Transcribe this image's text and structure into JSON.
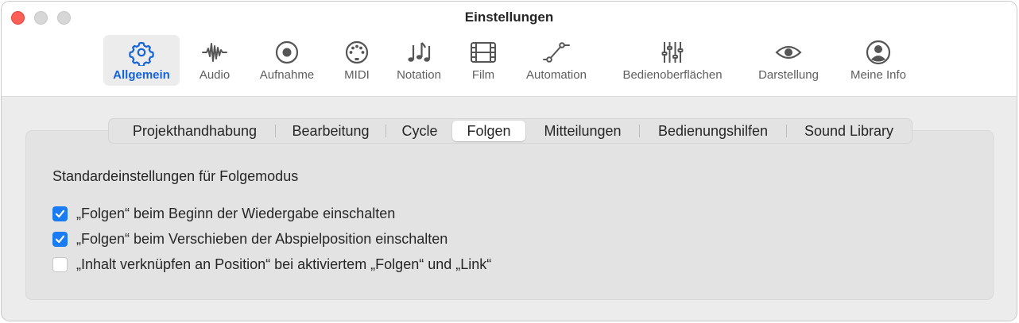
{
  "window": {
    "title": "Einstellungen"
  },
  "toolbar": {
    "items": [
      {
        "label": "Allgemein",
        "icon": "gear-icon",
        "selected": true
      },
      {
        "label": "Audio",
        "icon": "waveform-icon",
        "selected": false
      },
      {
        "label": "Aufnahme",
        "icon": "record-icon",
        "selected": false
      },
      {
        "label": "MIDI",
        "icon": "midi-connector-icon",
        "selected": false
      },
      {
        "label": "Notation",
        "icon": "music-notes-icon",
        "selected": false
      },
      {
        "label": "Film",
        "icon": "film-strip-icon",
        "selected": false
      },
      {
        "label": "Automation",
        "icon": "automation-curve-icon",
        "selected": false
      },
      {
        "label": "Bedienoberflächen",
        "icon": "faders-icon",
        "selected": false
      },
      {
        "label": "Darstellung",
        "icon": "eye-icon",
        "selected": false
      },
      {
        "label": "Meine Info",
        "icon": "person-icon",
        "selected": false
      }
    ]
  },
  "tabs": [
    {
      "label": "Projekthandhabung",
      "selected": false
    },
    {
      "label": "Bearbeitung",
      "selected": false
    },
    {
      "label": "Cycle",
      "selected": false
    },
    {
      "label": "Folgen",
      "selected": true
    },
    {
      "label": "Mitteilungen",
      "selected": false
    },
    {
      "label": "Bedienungshilfen",
      "selected": false
    },
    {
      "label": "Sound Library",
      "selected": false
    }
  ],
  "section": {
    "title": "Standardeinstellungen für Folgemodus",
    "options": [
      {
        "label": "„Folgen“ beim Beginn der Wiedergabe einschalten",
        "checked": true
      },
      {
        "label": "„Folgen“ beim Verschieben der Abspielposition einschalten",
        "checked": true
      },
      {
        "label": "„Inhalt verknüpfen an Position“ bei aktiviertem „Folgen“ und „Link“",
        "checked": false
      }
    ]
  },
  "colors": {
    "accent": "#1463d8",
    "checkbox_on": "#1a7cf5",
    "close_button": "#fe5f57"
  }
}
